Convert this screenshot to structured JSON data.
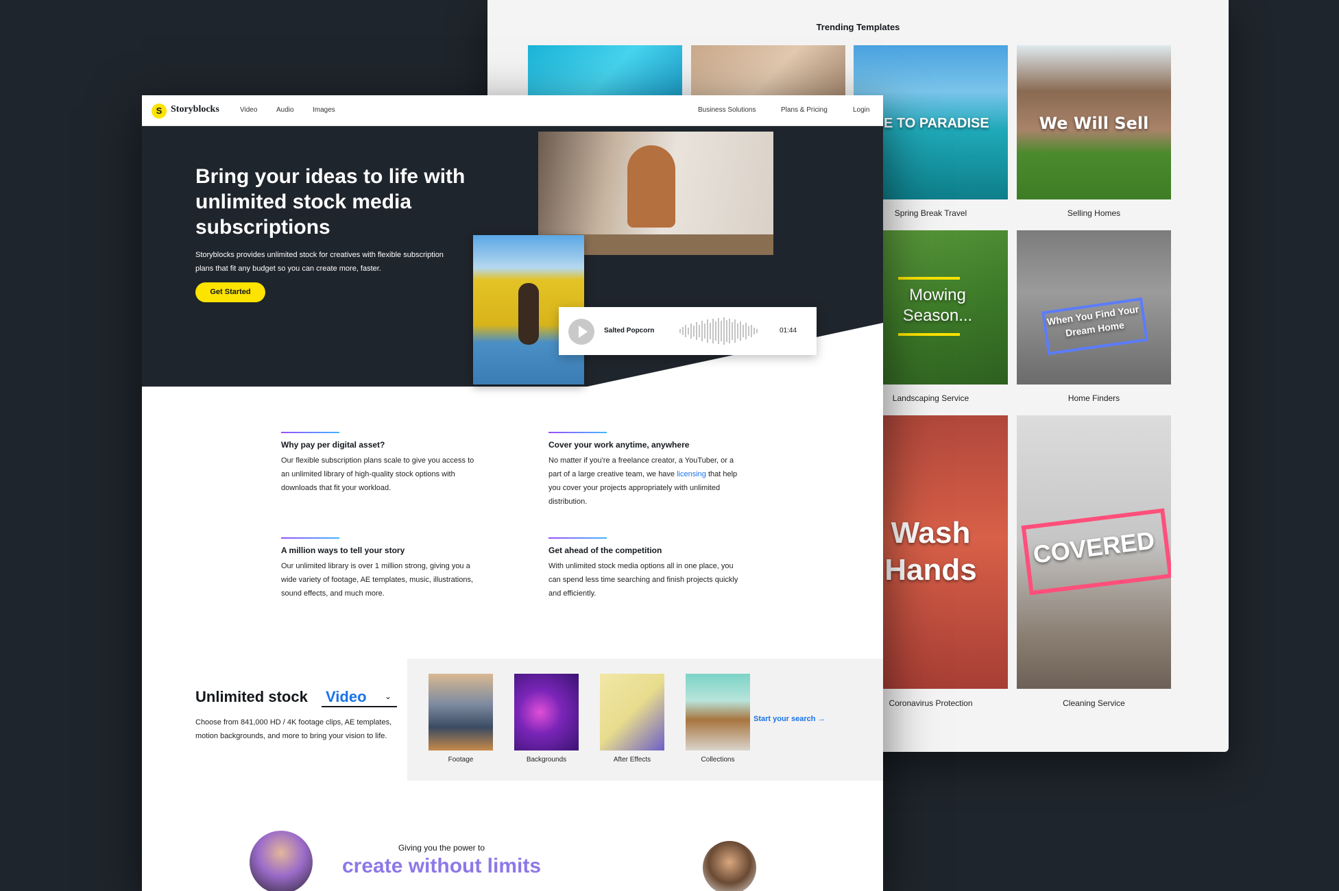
{
  "colors": {
    "accent_yellow": "#fce300",
    "link_blue": "#1a73e8",
    "hero_bg": "#1f252c",
    "gradient_purple": "#8d78e8"
  },
  "trending": {
    "title": "Trending Templates",
    "tiles": [
      {
        "caption": "",
        "overlay": ""
      },
      {
        "caption": "",
        "overlay": ""
      },
      {
        "caption": "Spring Break Travel",
        "overlay": "ME TO PARADISE"
      },
      {
        "caption": "Selling Homes",
        "overlay": "We Will Sell"
      },
      {
        "caption": "Landscaping Service",
        "overlay": "Mowing Season..."
      },
      {
        "caption": "Home Finders",
        "overlay": "When You Find Your Dream Home"
      },
      {
        "caption": "Coronavirus Protection",
        "overlay": "Wash Hands"
      },
      {
        "caption": "Cleaning Service",
        "overlay": "COVERED"
      }
    ]
  },
  "nav": {
    "logo_mark": "S",
    "logo": "Storyblocks",
    "links": [
      "Video",
      "Audio",
      "Images"
    ],
    "right_links": [
      "Business Solutions",
      "Plans & Pricing",
      "Login"
    ]
  },
  "hero": {
    "title": "Bring your ideas to life with unlimited stock media subscriptions",
    "subtitle": "Storyblocks provides unlimited stock for creatives with flexible subscription plans that fit any budget so you can create more, faster.",
    "cta": "Get Started",
    "audio": {
      "track": "Salted Popcorn",
      "duration": "01:44",
      "icon": "play-icon"
    }
  },
  "features": [
    {
      "title": "Why pay per digital asset?",
      "text": "Our flexible subscription plans scale to give you access to an unlimited library of high-quality stock options with downloads that fit your workload."
    },
    {
      "title": "Cover your work anytime, anywhere",
      "text_before": "No matter if you're a freelance creator, a YouTuber, or a part of a large creative team, we have ",
      "link": "licensing",
      "text_after": " that help you cover your projects appropriately with unlimited distribution."
    },
    {
      "title": "A million ways to tell your story",
      "text": "Our unlimited library is over 1 million strong, giving you a wide variety of footage, AE templates, music, illustrations, sound effects, and much more."
    },
    {
      "title": "Get ahead of the competition",
      "text": "With unlimited stock media options all in one place, you can spend less time searching and finish projects quickly and efficiently."
    }
  ],
  "unlimited": {
    "title": "Unlimited stock",
    "selected": "Video",
    "description": "Choose from 841,000 HD / 4K footage clips, AE templates, motion backgrounds, and more to bring your vision to life.",
    "categories": [
      "Footage",
      "Backgrounds",
      "After Effects",
      "Collections"
    ],
    "start_search": "Start your search →"
  },
  "power": {
    "subtitle": "Giving you the power to",
    "title": "create without limits"
  }
}
